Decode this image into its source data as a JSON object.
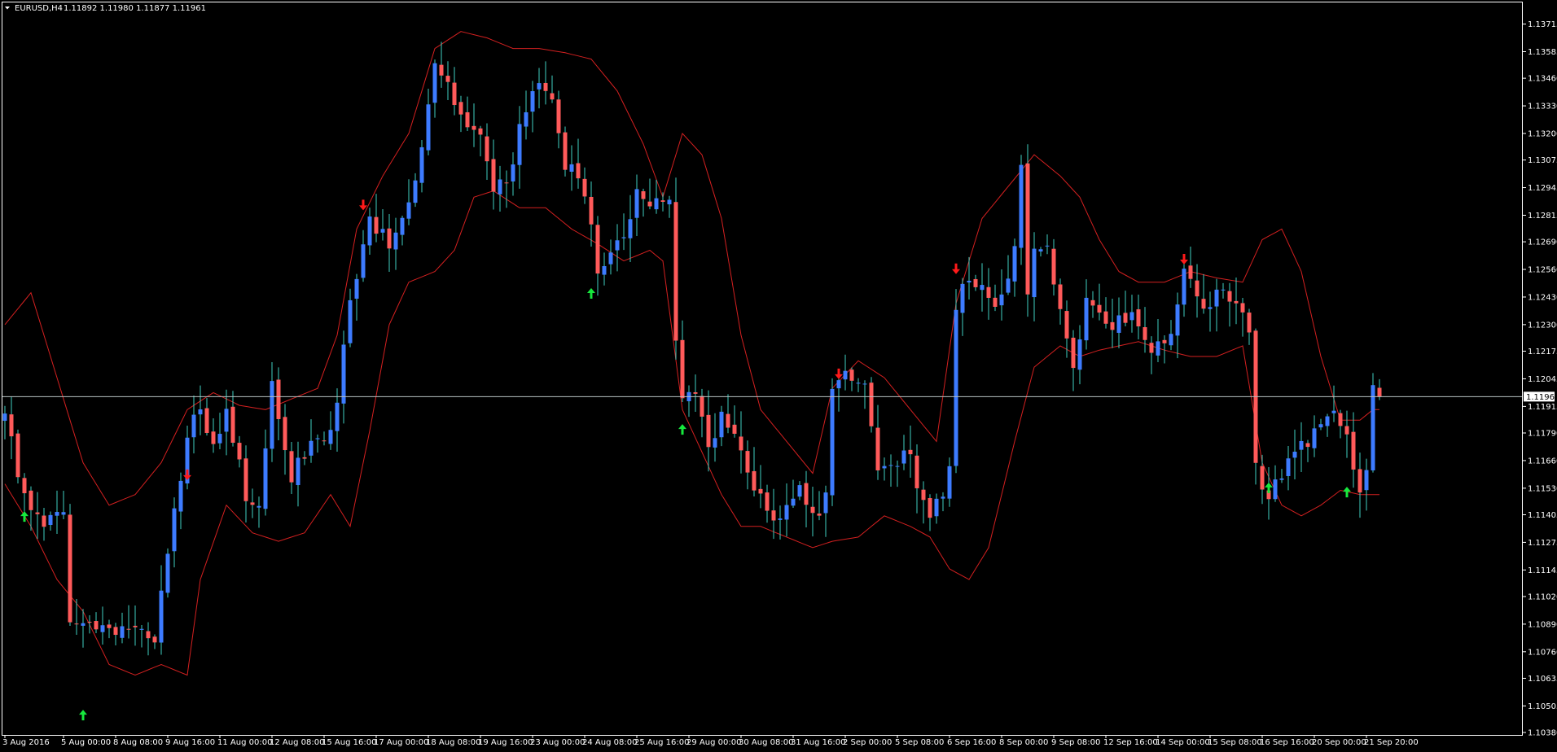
{
  "header": {
    "symbol": "EURUSD,H4",
    "ohlc": "1.11892 1.11980 1.11877 1.11961"
  },
  "colors": {
    "background": "#000000",
    "bull": "#3d7bff",
    "bear": "#ff5a5a",
    "wick": "#3fd1c2",
    "band": "#d42020",
    "arrow_up": "#16e83d",
    "arrow_down": "#ff1a1a",
    "axis": "#ffffff",
    "price_line": "#b8c2c2"
  },
  "chart_data": {
    "type": "candlestick",
    "symbol": "EURUSD",
    "timeframe": "H4",
    "current_price": 1.11961,
    "current_price_label": "1.11961",
    "ylim": [
      1.1038,
      1.1379
    ],
    "y_ticks": [
      {
        "value": 1.13715,
        "label": "1.13715"
      },
      {
        "value": 1.13585,
        "label": "1.13585"
      },
      {
        "value": 1.1346,
        "label": "1.13460"
      },
      {
        "value": 1.1333,
        "label": "1.13330"
      },
      {
        "value": 1.132,
        "label": "1.13200"
      },
      {
        "value": 1.13075,
        "label": "1.13075"
      },
      {
        "value": 1.12945,
        "label": "1.12945"
      },
      {
        "value": 1.12815,
        "label": "1.12815"
      },
      {
        "value": 1.1269,
        "label": "1.12690"
      },
      {
        "value": 1.1256,
        "label": "1.12560"
      },
      {
        "value": 1.1243,
        "label": "1.12430"
      },
      {
        "value": 1.123,
        "label": "1.12300"
      },
      {
        "value": 1.12175,
        "label": "1.12175"
      },
      {
        "value": 1.12045,
        "label": "1.12045"
      },
      {
        "value": 1.11915,
        "label": "1.11915"
      },
      {
        "value": 1.1179,
        "label": "1.11790"
      },
      {
        "value": 1.1166,
        "label": "1.11660"
      },
      {
        "value": 1.1153,
        "label": "1.11530"
      },
      {
        "value": 1.11405,
        "label": "1.11405"
      },
      {
        "value": 1.11275,
        "label": "1.11275"
      },
      {
        "value": 1.11145,
        "label": "1.11145"
      },
      {
        "value": 1.1102,
        "label": "1.11020"
      },
      {
        "value": 1.1089,
        "label": "1.10890"
      },
      {
        "value": 1.1076,
        "label": "1.10760"
      },
      {
        "value": 1.10635,
        "label": "1.10635"
      },
      {
        "value": 1.10505,
        "label": "1.10505"
      },
      {
        "value": 1.1038,
        "label": "1.10380"
      }
    ],
    "x_labels": [
      {
        "bar": 0,
        "label": "3 Aug 2016"
      },
      {
        "bar": 9,
        "label": "5 Aug 00:00"
      },
      {
        "bar": 17,
        "label": "8 Aug 08:00"
      },
      {
        "bar": 25,
        "label": "9 Aug 16:00"
      },
      {
        "bar": 33,
        "label": "11 Aug 00:00"
      },
      {
        "bar": 41,
        "label": "12 Aug 08:00"
      },
      {
        "bar": 49,
        "label": "15 Aug 16:00"
      },
      {
        "bar": 57,
        "label": "17 Aug 00:00"
      },
      {
        "bar": 65,
        "label": "18 Aug 08:00"
      },
      {
        "bar": 73,
        "label": "19 Aug 16:00"
      },
      {
        "bar": 81,
        "label": "23 Aug 00:00"
      },
      {
        "bar": 89,
        "label": "24 Aug 08:00"
      },
      {
        "bar": 97,
        "label": "25 Aug 16:00"
      },
      {
        "bar": 105,
        "label": "29 Aug 00:00"
      },
      {
        "bar": 113,
        "label": "30 Aug 08:00"
      },
      {
        "bar": 121,
        "label": "31 Aug 16:00"
      },
      {
        "bar": 129,
        "label": "2 Sep 00:00"
      },
      {
        "bar": 137,
        "label": "5 Sep 08:00"
      },
      {
        "bar": 145,
        "label": "6 Sep 16:00"
      },
      {
        "bar": 153,
        "label": "8 Sep 00:00"
      },
      {
        "bar": 161,
        "label": "9 Sep 08:00"
      },
      {
        "bar": 169,
        "label": "12 Sep 16:00"
      },
      {
        "bar": 177,
        "label": "14 Sep 00:00"
      },
      {
        "bar": 185,
        "label": "15 Sep 08:00"
      },
      {
        "bar": 193,
        "label": "16 Sep 16:00"
      },
      {
        "bar": 201,
        "label": "20 Sep 00:00"
      },
      {
        "bar": 209,
        "label": "21 Sep 20:00"
      }
    ],
    "series": [
      {
        "type": "candlestick",
        "waypoints": [
          [
            0,
            1.1188
          ],
          [
            3,
            1.115
          ],
          [
            6,
            1.1138
          ],
          [
            9,
            1.114
          ],
          [
            10,
            1.109
          ],
          [
            13,
            1.1086
          ],
          [
            18,
            1.1085
          ],
          [
            23,
            1.1084
          ],
          [
            26,
            1.114
          ],
          [
            29,
            1.1191
          ],
          [
            32,
            1.1175
          ],
          [
            34,
            1.1188
          ],
          [
            37,
            1.115
          ],
          [
            39,
            1.1144
          ],
          [
            41,
            1.1203
          ],
          [
            44,
            1.116
          ],
          [
            47,
            1.1175
          ],
          [
            50,
            1.118
          ],
          [
            51,
            1.1192
          ],
          [
            53,
            1.1242
          ],
          [
            56,
            1.1278
          ],
          [
            59,
            1.1268
          ],
          [
            61,
            1.1282
          ],
          [
            64,
            1.131
          ],
          [
            66,
            1.135
          ],
          [
            68,
            1.1342
          ],
          [
            70,
            1.1325
          ],
          [
            73,
            1.1318
          ],
          [
            75,
            1.129
          ],
          [
            77,
            1.1298
          ],
          [
            79,
            1.132
          ],
          [
            81,
            1.134
          ],
          [
            84,
            1.134
          ],
          [
            86,
            1.1305
          ],
          [
            89,
            1.1293
          ],
          [
            91,
            1.1255
          ],
          [
            93,
            1.1262
          ],
          [
            95,
            1.1275
          ],
          [
            97,
            1.129
          ],
          [
            100,
            1.1288
          ],
          [
            102,
            1.1292
          ],
          [
            103,
            1.122
          ],
          [
            104,
            1.1195
          ],
          [
            106,
            1.12
          ],
          [
            108,
            1.117
          ],
          [
            110,
            1.1188
          ],
          [
            112,
            1.1175
          ],
          [
            114,
            1.116
          ],
          [
            116,
            1.1148
          ],
          [
            118,
            1.114
          ],
          [
            120,
            1.1145
          ],
          [
            122,
            1.1152
          ],
          [
            124,
            1.1138
          ],
          [
            126,
            1.115
          ],
          [
            127,
            1.12
          ],
          [
            128,
            1.1202
          ],
          [
            130,
            1.1207
          ],
          [
            132,
            1.1205
          ],
          [
            134,
            1.1165
          ],
          [
            136,
            1.116
          ],
          [
            139,
            1.117
          ],
          [
            140,
            1.115
          ],
          [
            142,
            1.1142
          ],
          [
            144,
            1.1148
          ],
          [
            145,
            1.1165
          ],
          [
            146,
            1.124
          ],
          [
            148,
            1.125
          ],
          [
            150,
            1.1245
          ],
          [
            152,
            1.1235
          ],
          [
            155,
            1.1265
          ],
          [
            156,
            1.1303
          ],
          [
            157,
            1.1245
          ],
          [
            158,
            1.1262
          ],
          [
            160,
            1.127
          ],
          [
            162,
            1.1235
          ],
          [
            163,
            1.1225
          ],
          [
            164,
            1.121
          ],
          [
            166,
            1.124
          ],
          [
            168,
            1.1232
          ],
          [
            170,
            1.1228
          ],
          [
            172,
            1.1235
          ],
          [
            174,
            1.123
          ],
          [
            176,
            1.122
          ],
          [
            178,
            1.1225
          ],
          [
            180,
            1.1235
          ],
          [
            181,
            1.1255
          ],
          [
            183,
            1.1245
          ],
          [
            185,
            1.1235
          ],
          [
            187,
            1.125
          ],
          [
            189,
            1.124
          ],
          [
            191,
            1.123
          ],
          [
            192,
            1.1165
          ],
          [
            194,
            1.1148
          ],
          [
            196,
            1.116
          ],
          [
            198,
            1.117
          ],
          [
            200,
            1.1175
          ],
          [
            202,
            1.118
          ],
          [
            204,
            1.1185
          ],
          [
            206,
            1.1175
          ],
          [
            207,
            1.1165
          ],
          [
            208,
            1.115
          ],
          [
            209,
            1.116
          ],
          [
            210,
            1.1198
          ],
          [
            211,
            1.11961
          ]
        ]
      },
      {
        "type": "band",
        "name": "upper",
        "waypoints": [
          [
            0,
            1.123
          ],
          [
            4,
            1.1245
          ],
          [
            8,
            1.1205
          ],
          [
            12,
            1.1165
          ],
          [
            16,
            1.1145
          ],
          [
            20,
            1.115
          ],
          [
            24,
            1.1165
          ],
          [
            28,
            1.119
          ],
          [
            32,
            1.1198
          ],
          [
            36,
            1.1192
          ],
          [
            40,
            1.119
          ],
          [
            44,
            1.1195
          ],
          [
            48,
            1.12
          ],
          [
            51,
            1.1225
          ],
          [
            54,
            1.1275
          ],
          [
            58,
            1.13
          ],
          [
            62,
            1.132
          ],
          [
            66,
            1.136
          ],
          [
            70,
            1.1368
          ],
          [
            74,
            1.1365
          ],
          [
            78,
            1.136
          ],
          [
            82,
            1.136
          ],
          [
            86,
            1.1358
          ],
          [
            90,
            1.1355
          ],
          [
            94,
            1.134
          ],
          [
            98,
            1.1315
          ],
          [
            101,
            1.129
          ],
          [
            104,
            1.132
          ],
          [
            107,
            1.131
          ],
          [
            110,
            1.128
          ],
          [
            113,
            1.1225
          ],
          [
            116,
            1.119
          ],
          [
            120,
            1.1175
          ],
          [
            124,
            1.116
          ],
          [
            127,
            1.12
          ],
          [
            131,
            1.1213
          ],
          [
            135,
            1.1205
          ],
          [
            139,
            1.119
          ],
          [
            143,
            1.1175
          ],
          [
            146,
            1.124
          ],
          [
            150,
            1.128
          ],
          [
            154,
            1.1295
          ],
          [
            158,
            1.131
          ],
          [
            162,
            1.13
          ],
          [
            165,
            1.129
          ],
          [
            168,
            1.127
          ],
          [
            171,
            1.1255
          ],
          [
            174,
            1.125
          ],
          [
            178,
            1.125
          ],
          [
            182,
            1.1255
          ],
          [
            186,
            1.1252
          ],
          [
            190,
            1.125
          ],
          [
            193,
            1.127
          ],
          [
            196,
            1.1275
          ],
          [
            199,
            1.1255
          ],
          [
            202,
            1.1215
          ],
          [
            205,
            1.1185
          ],
          [
            208,
            1.1185
          ],
          [
            210,
            1.119
          ]
        ]
      },
      {
        "type": "band",
        "name": "lower",
        "waypoints": [
          [
            0,
            1.1155
          ],
          [
            4,
            1.1135
          ],
          [
            8,
            1.111
          ],
          [
            12,
            1.1095
          ],
          [
            16,
            1.107
          ],
          [
            20,
            1.1065
          ],
          [
            24,
            1.107
          ],
          [
            28,
            1.1065
          ],
          [
            30,
            1.111
          ],
          [
            34,
            1.1145
          ],
          [
            38,
            1.1132
          ],
          [
            42,
            1.1128
          ],
          [
            46,
            1.1132
          ],
          [
            50,
            1.115
          ],
          [
            53,
            1.1135
          ],
          [
            56,
            1.118
          ],
          [
            59,
            1.123
          ],
          [
            62,
            1.125
          ],
          [
            66,
            1.1255
          ],
          [
            69,
            1.1265
          ],
          [
            72,
            1.129
          ],
          [
            75,
            1.1293
          ],
          [
            79,
            1.1285
          ],
          [
            83,
            1.1285
          ],
          [
            87,
            1.1275
          ],
          [
            91,
            1.1268
          ],
          [
            95,
            1.126
          ],
          [
            99,
            1.1265
          ],
          [
            101,
            1.126
          ],
          [
            104,
            1.119
          ],
          [
            107,
            1.117
          ],
          [
            110,
            1.115
          ],
          [
            113,
            1.1135
          ],
          [
            116,
            1.1135
          ],
          [
            120,
            1.113
          ],
          [
            124,
            1.1125
          ],
          [
            127,
            1.1128
          ],
          [
            131,
            1.113
          ],
          [
            135,
            1.114
          ],
          [
            139,
            1.1135
          ],
          [
            142,
            1.113
          ],
          [
            145,
            1.1115
          ],
          [
            148,
            1.111
          ],
          [
            151,
            1.1125
          ],
          [
            155,
            1.1175
          ],
          [
            158,
            1.121
          ],
          [
            162,
            1.122
          ],
          [
            165,
            1.1215
          ],
          [
            168,
            1.1218
          ],
          [
            171,
            1.122
          ],
          [
            174,
            1.1222
          ],
          [
            178,
            1.1218
          ],
          [
            182,
            1.1215
          ],
          [
            186,
            1.1215
          ],
          [
            190,
            1.122
          ],
          [
            193,
            1.1165
          ],
          [
            196,
            1.1145
          ],
          [
            199,
            1.114
          ],
          [
            202,
            1.1145
          ],
          [
            205,
            1.1152
          ],
          [
            208,
            1.115
          ],
          [
            210,
            1.115
          ]
        ]
      }
    ],
    "signals": [
      {
        "bar": 3,
        "dir": "up",
        "price": 1.11395
      },
      {
        "bar": 12,
        "dir": "up",
        "price": 1.1046
      },
      {
        "bar": 28,
        "dir": "down",
        "price": 1.11595
      },
      {
        "bar": 55,
        "dir": "down",
        "price": 1.12865
      },
      {
        "bar": 90,
        "dir": "up",
        "price": 1.12445
      },
      {
        "bar": 104,
        "dir": "up",
        "price": 1.11805
      },
      {
        "bar": 128,
        "dir": "down",
        "price": 1.1207
      },
      {
        "bar": 146,
        "dir": "down",
        "price": 1.12565
      },
      {
        "bar": 181,
        "dir": "down",
        "price": 1.1261
      },
      {
        "bar": 194,
        "dir": "up",
        "price": 1.1153
      },
      {
        "bar": 206,
        "dir": "up",
        "price": 1.1151
      }
    ]
  }
}
